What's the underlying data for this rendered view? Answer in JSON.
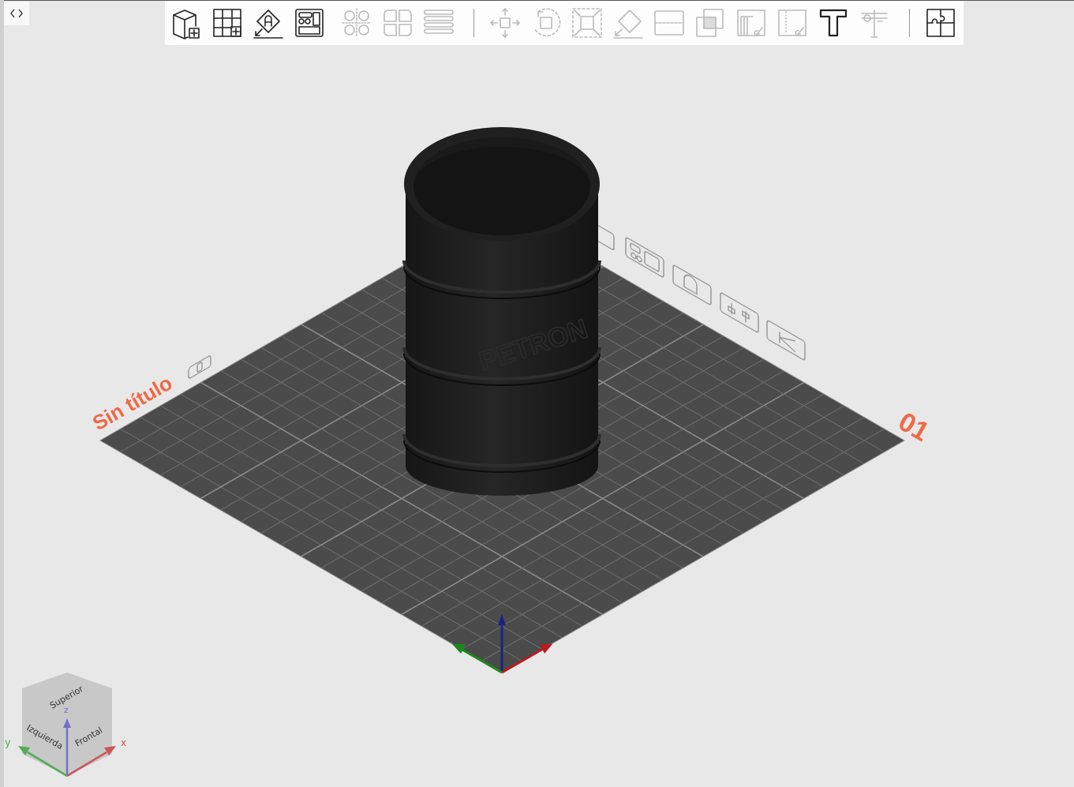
{
  "toolbar": {
    "groups": [
      {
        "items": [
          {
            "name": "add-shape",
            "icon": "cube-plus-icon",
            "enabled": true
          },
          {
            "name": "add-grid",
            "icon": "grid-plus-icon",
            "enabled": true
          },
          {
            "name": "place-text",
            "icon": "diamond-a-icon",
            "enabled": true
          },
          {
            "name": "layout",
            "icon": "layout-icon",
            "enabled": true
          },
          {
            "name": "mirror-circles",
            "icon": "circles-icon",
            "enabled": false
          },
          {
            "name": "mirror-shapes",
            "icon": "mirror-icon",
            "enabled": false
          },
          {
            "name": "list",
            "icon": "rows-icon",
            "enabled": false
          }
        ]
      },
      {
        "items": [
          {
            "name": "move",
            "icon": "move-icon",
            "enabled": false
          },
          {
            "name": "rotate",
            "icon": "rotate-icon",
            "enabled": false
          },
          {
            "name": "scale",
            "icon": "scale-icon",
            "enabled": false
          },
          {
            "name": "place-on-face",
            "icon": "diamond-arrow-icon",
            "enabled": false
          },
          {
            "name": "split",
            "icon": "split-icon",
            "enabled": false
          },
          {
            "name": "intersect",
            "icon": "intersect-icon",
            "enabled": false
          },
          {
            "name": "paint-stripes",
            "icon": "paint-stripes-icon",
            "enabled": false
          },
          {
            "name": "paint-dots",
            "icon": "paint-dots-icon",
            "enabled": false
          },
          {
            "name": "text",
            "icon": "text-t-icon",
            "enabled": true
          },
          {
            "name": "caliper",
            "icon": "caliper-icon",
            "enabled": false
          }
        ]
      },
      {
        "items": [
          {
            "name": "puzzle",
            "icon": "puzzle-icon",
            "enabled": true
          }
        ]
      }
    ]
  },
  "scene": {
    "plate_title": "Sin título",
    "plate_number": "01",
    "barrel_text": "PETRON",
    "accent": "#ee6a45",
    "plate_color": "#4a4b4a",
    "model_color": "#1e1e1e"
  },
  "view_cube": {
    "top": "Superior",
    "left": "Izquierda",
    "front": "Frontal",
    "x": "x",
    "y": "y",
    "z": "z"
  },
  "colors": {
    "x": "#cc5555",
    "y": "#55aa55",
    "z": "#7070cc"
  }
}
